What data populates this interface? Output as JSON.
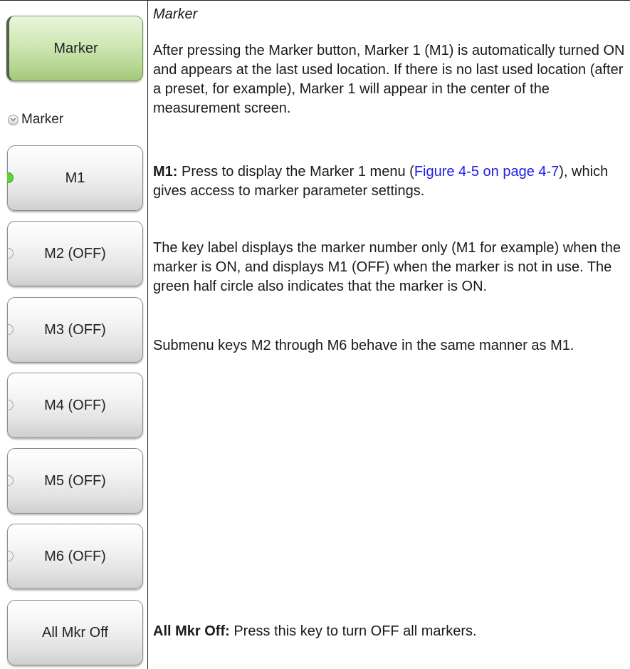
{
  "softkeys": {
    "marker": "Marker",
    "submenu_label": "Marker",
    "m1": "M1",
    "m2": "M2 (OFF)",
    "m3": "M3 (OFF)",
    "m4": "M4 (OFF)",
    "m5": "M5 (OFF)",
    "m6": "M6 (OFF)",
    "all_off": "All Mkr Off"
  },
  "desc": {
    "heading": "Marker",
    "p1": "After pressing the Marker button, Marker 1 (M1) is automatically turned ON and appears at the last used location. If there is no last used location (after a preset, for example), Marker 1 will appear in the center of the measurement screen.",
    "m1_term": "M1:",
    "m1_text_a": "  Press to display the Marker 1 menu (",
    "m1_link": "Figure 4-5 on page 4-7",
    "m1_text_b": "), which gives access to marker parameter settings.",
    "p3": "The key label displays the marker number only (M1 for example) when the marker is ON, and displays M1 (OFF) when the marker is not in use. The green half circle also indicates that the marker is ON.",
    "p4": "Submenu keys M2 through M6 behave in the same manner as M1.",
    "alloff_term": "All Mkr Off:",
    "alloff_text": "  Press this key to turn OFF all markers."
  },
  "colors": {
    "active_key": "#b5d590",
    "on_indicator": "#5fd43a",
    "link": "#1f1fe6"
  },
  "icons": [
    "chevron-down-icon",
    "on-indicator-icon",
    "off-indicator-icon"
  ]
}
